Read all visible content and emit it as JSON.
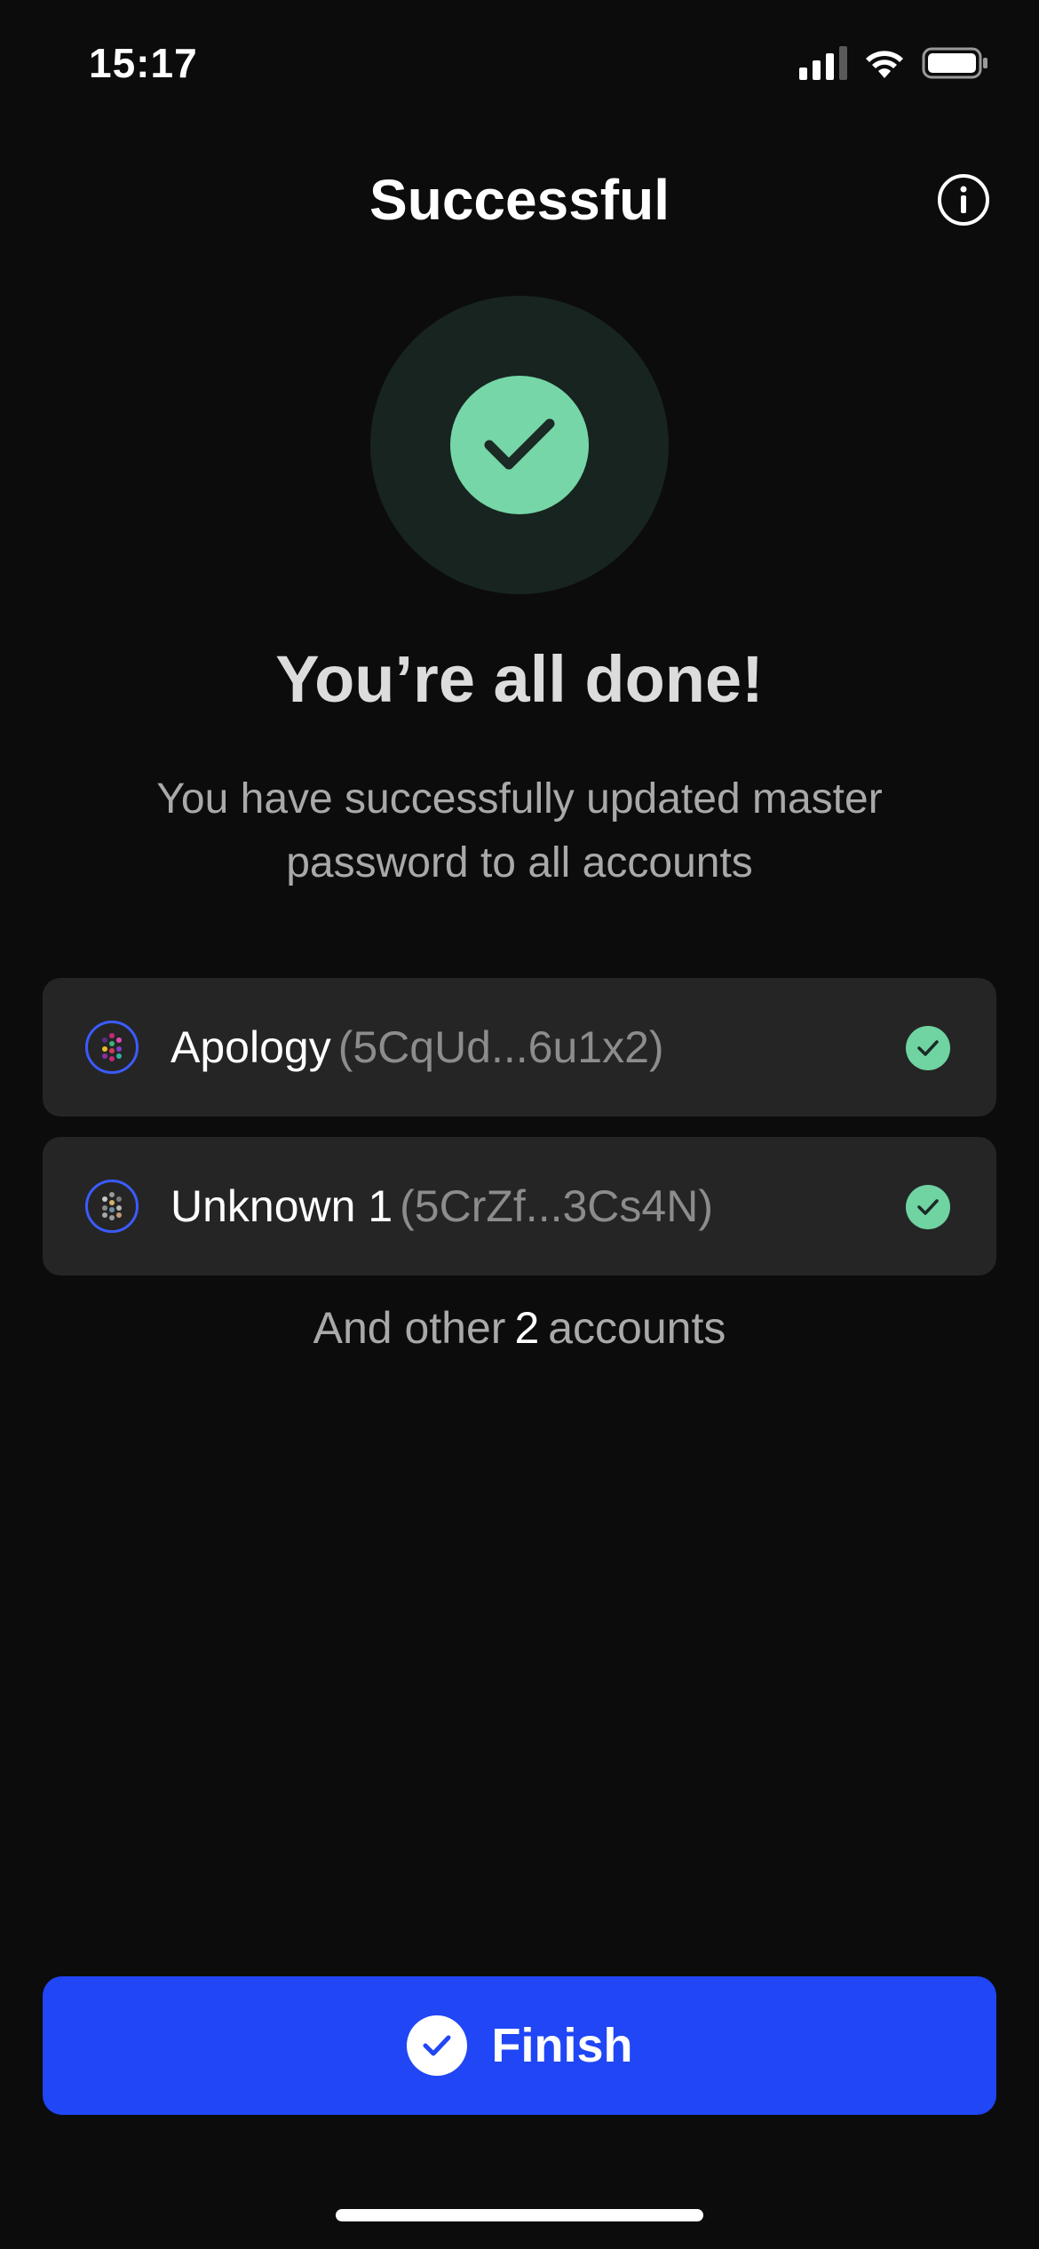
{
  "status_bar": {
    "time": "15:17",
    "icons": [
      "signal-icon",
      "wifi-icon",
      "battery-icon"
    ]
  },
  "header": {
    "title": "Successful",
    "info_icon": "info-icon"
  },
  "success": {
    "icon": "check-icon",
    "title": "You’re all done!",
    "description": "You have successfully updated master password to all accounts"
  },
  "accounts": [
    {
      "name": "Apology",
      "address": "(5CqUd...6u1x2)",
      "status_icon": "check-icon"
    },
    {
      "name": "Unknown 1",
      "address": "(5CrZf...3Cs4N)",
      "status_icon": "check-icon"
    }
  ],
  "others": {
    "prefix": "And other",
    "count": "2",
    "suffix": "accounts"
  },
  "finish_button": {
    "label": "Finish",
    "icon": "check-circle-icon"
  },
  "colors": {
    "background": "#0c0c0c",
    "card": "#252525",
    "success_green": "#76d6a8",
    "primary_blue": "#2046f5",
    "avatar_ring": "#3b5bff"
  }
}
